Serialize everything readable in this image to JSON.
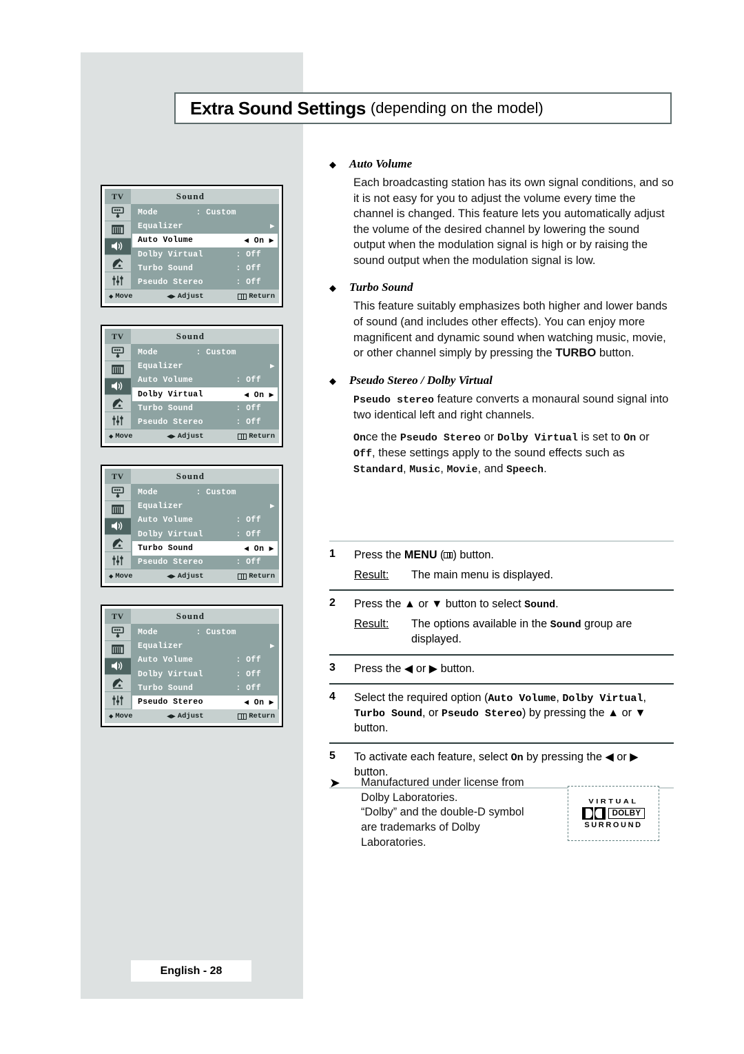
{
  "header": {
    "title_main": "Extra Sound Settings",
    "title_sub": "(depending on the model)"
  },
  "osd_common": {
    "tv_label": "TV",
    "menu_title": "Sound",
    "footer": {
      "move": "Move",
      "adjust": "Adjust",
      "return": "Return"
    },
    "rail_icons": [
      "picture-icon",
      "equalizer-icon",
      "speaker-icon",
      "satellite-dish-icon",
      "sliders-icon"
    ],
    "mode_label": "Mode",
    "mode_value": "Custom",
    "equalizer_label": "Equalizer",
    "on_value": "On",
    "off_value": "Off",
    "colon": ":"
  },
  "osd_panels": [
    {
      "selected": "Auto Volume",
      "rows": [
        {
          "label": "Mode",
          "value": "Custom",
          "type": "value"
        },
        {
          "label": "Equalizer",
          "value": "",
          "type": "submenu"
        },
        {
          "label": "Auto Volume",
          "value": "On",
          "type": "selected"
        },
        {
          "label": "Dolby Virtual",
          "value": "Off",
          "type": "value"
        },
        {
          "label": "Turbo Sound",
          "value": "Off",
          "type": "value"
        },
        {
          "label": "Pseudo Stereo",
          "value": "Off",
          "type": "value"
        }
      ]
    },
    {
      "selected": "Dolby Virtual",
      "rows": [
        {
          "label": "Mode",
          "value": "Custom",
          "type": "value"
        },
        {
          "label": "Equalizer",
          "value": "",
          "type": "submenu"
        },
        {
          "label": "Auto Volume",
          "value": "Off",
          "type": "value"
        },
        {
          "label": "Dolby Virtual",
          "value": "On",
          "type": "selected"
        },
        {
          "label": "Turbo Sound",
          "value": "Off",
          "type": "value"
        },
        {
          "label": "Pseudo Stereo",
          "value": "Off",
          "type": "value"
        }
      ]
    },
    {
      "selected": "Turbo Sound",
      "rows": [
        {
          "label": "Mode",
          "value": "Custom",
          "type": "value"
        },
        {
          "label": "Equalizer",
          "value": "",
          "type": "submenu"
        },
        {
          "label": "Auto Volume",
          "value": "Off",
          "type": "value"
        },
        {
          "label": "Dolby Virtual",
          "value": "Off",
          "type": "value"
        },
        {
          "label": "Turbo Sound",
          "value": "On",
          "type": "selected"
        },
        {
          "label": "Pseudo Stereo",
          "value": "Off",
          "type": "value"
        }
      ]
    },
    {
      "selected": "Pseudo Stereo",
      "rows": [
        {
          "label": "Mode",
          "value": "Custom",
          "type": "value"
        },
        {
          "label": "Equalizer",
          "value": "",
          "type": "submenu"
        },
        {
          "label": "Auto Volume",
          "value": "Off",
          "type": "value"
        },
        {
          "label": "Dolby Virtual",
          "value": "Off",
          "type": "value"
        },
        {
          "label": "Turbo Sound",
          "value": "Off",
          "type": "value"
        },
        {
          "label": "Pseudo Stereo",
          "value": "On",
          "type": "selected"
        }
      ]
    }
  ],
  "sections": [
    {
      "title": "Auto Volume",
      "paragraphs": [
        "Each broadcasting station has its own signal conditions, and so it is not easy for you to adjust the volume every time the channel is changed. This feature lets you automatically adjust the volume of the desired channel by lowering the sound output when the modulation signal is high or by raising the sound output when the modulation signal is low."
      ]
    },
    {
      "title": "Turbo Sound",
      "paragraphs": [
        "This feature suitably emphasizes both higher and lower bands of sound (and includes other effects). You can enjoy more magnificent and dynamic sound when watching music, movie, or other channel simply by pressing the TURBO button."
      ]
    },
    {
      "title": "Pseudo Stereo / Dolby Virtual",
      "paragraphs": [
        "Pseudo stereo feature converts a monaural sound signal into two identical left and right channels.",
        "Once the Pseudo Stereo or Dolby Virtual is set to On or Off, these settings apply to the sound effects such as Standard, Music, Movie, and Speech."
      ]
    }
  ],
  "steps": [
    {
      "num": "1",
      "instruction_pre": "Press the ",
      "instruction_bold": "MENU",
      "instruction_post": ") button.",
      "result_label": "Result:",
      "result_text": "The main menu is displayed."
    },
    {
      "num": "2",
      "instruction_pre": "Press the ▲ or ▼ button to select ",
      "instruction_mono": "Sound",
      "instruction_post": ".",
      "result_label": "Result:",
      "result_text_pre": "The options available in the ",
      "result_text_mono": "Sound",
      "result_text_post": " group are displayed."
    },
    {
      "num": "3",
      "instruction_pre": "Press the ◀ or ▶ button."
    },
    {
      "num": "4",
      "instruction_pre": "Select the required option (",
      "opt1": "Auto Volume",
      "sep1": ", ",
      "opt2": "Dolby Virtual",
      "sep2": ", ",
      "opt3": "Turbo Sound",
      "sep3": ", or ",
      "opt4": "Pseudo Stereo",
      "instruction_post": ") by pressing the ▲ or ▼ button."
    },
    {
      "num": "5",
      "instruction_pre": "To activate each feature, select ",
      "instruction_mono": "On",
      "instruction_post": " by pressing the ◀ or ▶ button."
    }
  ],
  "note": {
    "arrow": "➤",
    "line1": "Manufactured under license from",
    "line2": "Dolby Laboratories.",
    "line3": "“Dolby” and the double-D symbol",
    "line4": "are trademarks of Dolby",
    "line5": "Laboratories."
  },
  "dolby_logo": {
    "virtual": "VIRTUAL",
    "dolby": "DOLBY",
    "surround": "SURROUND"
  },
  "footer": {
    "page_label": "English - 28"
  },
  "colors": {
    "page_background": "#ffffff",
    "band_gray": "#dde1e1",
    "osd_body": "#8ea3a2",
    "osd_strip": "#c6d0cf",
    "osd_rail": "#9fb0af",
    "osd_active_icon": "#4e6462",
    "rule": "#c8d2d2",
    "title_border": "#5c6b6b"
  }
}
